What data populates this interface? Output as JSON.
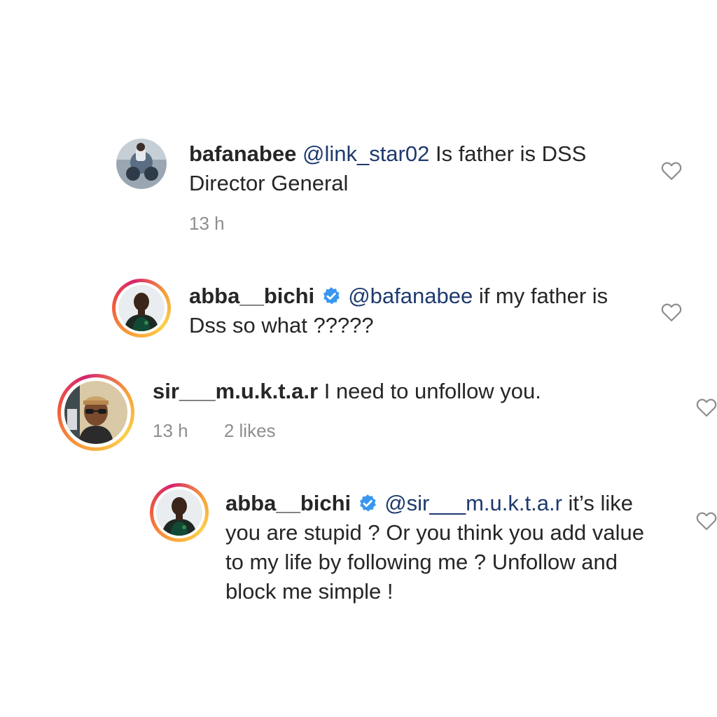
{
  "comments": [
    {
      "username": "bafanabee",
      "mention": "@link_star02",
      "text": " Is father is DSS Director General",
      "time": "13 h",
      "likes": "",
      "verified": false,
      "avatar": "motorbike-photo-avatar"
    },
    {
      "username": "abba__bichi",
      "mention": "@bafanabee",
      "text": " if my father is Dss so what ?????",
      "time": "",
      "likes": "",
      "verified": true,
      "avatar": "green-jersey-photo-avatar"
    },
    {
      "username": "sir___m.u.k.t.a.r",
      "mention": "",
      "text": " I need to unfollow you.",
      "time": "13 h",
      "likes": "2 likes",
      "verified": false,
      "avatar": "cap-sunglasses-photo-avatar"
    },
    {
      "username": "abba__bichi",
      "mention": "@sir___m.u.k.t.a.r",
      "text": " it’s like you are stupid ? Or you think you add value to my life by following me ? Unfollow and block me simple !",
      "time": "",
      "likes": "",
      "verified": true,
      "avatar": "green-jersey-photo-avatar"
    }
  ],
  "colors": {
    "text": "#262626",
    "mention": "#1e3a6e",
    "meta": "#8e8e8e",
    "verified": "#3897f0",
    "heart": "#8e8e8e"
  },
  "icons": {
    "like": "heart-outline-icon",
    "verified": "verified-badge-icon"
  }
}
